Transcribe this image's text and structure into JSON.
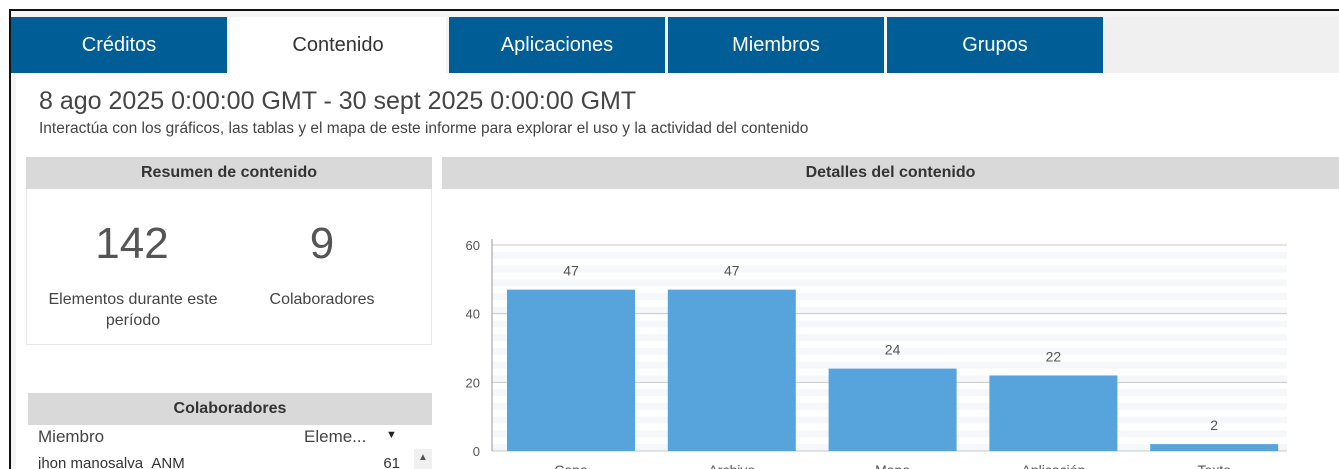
{
  "tabs": [
    {
      "label": "Créditos"
    },
    {
      "label": "Contenido"
    },
    {
      "label": "Aplicaciones"
    },
    {
      "label": "Miembros"
    },
    {
      "label": "Grupos"
    }
  ],
  "header": {
    "date_range": "8 ago 2025 0:00:00 GMT - 30 sept 2025 0:00:00 GMT",
    "subtitle": "Interactúa con los gráficos, las tablas y el mapa de este informe para explorar el uso y la actividad del contenido"
  },
  "summary": {
    "title": "Resumen de contenido",
    "items_value": "142",
    "items_label": "Elementos durante este período",
    "collaborators_value": "9",
    "collaborators_label": "Colaboradores"
  },
  "collaborators_table": {
    "title": "Colaboradores",
    "col_member": "Miembro",
    "col_items": "Eleme...",
    "rows": [
      {
        "member": "jhon manosalva_ANM",
        "items": "61"
      }
    ]
  },
  "details": {
    "title": "Detalles del contenido"
  },
  "colors": {
    "tab_bg": "#005d96",
    "bar": "#57a3dc",
    "panel_header": "#d9d9d9"
  },
  "chart_data": {
    "type": "bar",
    "categories": [
      "Capa",
      "Archivo",
      "Mapa",
      "Aplicación",
      "Texto"
    ],
    "values": [
      47,
      47,
      24,
      22,
      2
    ],
    "ylim": [
      0,
      60
    ],
    "yticks": [
      0,
      20,
      40,
      60
    ],
    "grid": true,
    "data_labels": true
  }
}
